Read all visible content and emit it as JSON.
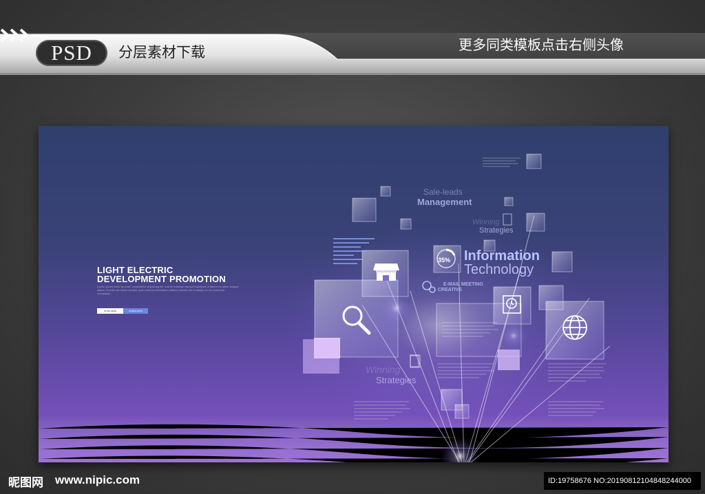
{
  "banner": {
    "badge": "PSD",
    "left_text": "分层素材下载",
    "right_text": "更多同类模板点击右侧头像",
    "chevron_icon": "triple-chevron-right-icon"
  },
  "artboard": {
    "headline_line1": "LIGHT ELECTRIC",
    "headline_line2": "DEVELOPMENT PROMOTION",
    "body_copy": "Lorem ipsum dolor sit amet, consectetur adipiscing elit, sed do eiusmod tempor incididunt ut labore et dolore magna aliqua. Ut enim ad minim veniam, quis nostrud exercitation ullamco laboris nisi ut aliquip ex ea commodo consequat.",
    "buttons": {
      "more": "MORE HERE",
      "mobile": "MOBILE APPS"
    },
    "labels": {
      "sale_leads": "Sale-leads",
      "management": "Management",
      "winning_top": "Winning",
      "strategies_top": "Strategies",
      "percent": "35%",
      "information": "Information",
      "technology": "Technology",
      "email_meeting": "E-MAIL MEETING",
      "creative": "CREATIVE",
      "winning_bottom": "Winning",
      "strategies_bottom": "Strategies"
    },
    "icons": [
      "store-icon",
      "search-icon",
      "globe-icon",
      "clock-icon",
      "percent-circle-icon",
      "gear-dollar-icon"
    ],
    "accent_colors": {
      "top": "#2f3f6e",
      "bottom": "#8454c4",
      "headline_accent": "#b6c4ff"
    }
  },
  "footer": {
    "logo": "昵图网",
    "url": "www.nipic.com",
    "id_text": "ID:19758676 NO:20190812104848244000"
  }
}
